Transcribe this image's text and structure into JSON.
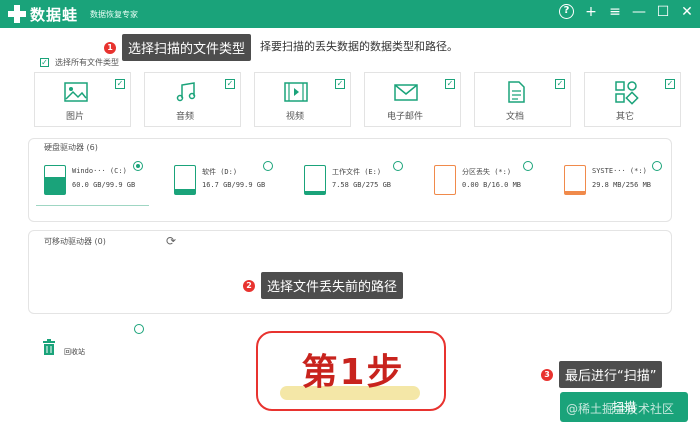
{
  "app": {
    "brand": "数据蛙",
    "subtitle": "数据恢复专家",
    "title_icons": [
      "help-icon",
      "plus-icon",
      "menu-icon",
      "minimize-icon",
      "maximize-icon",
      "close-icon"
    ],
    "accent_color": "#1aa37a"
  },
  "instruction": "择要扫描的丢失数据的数据类型和路径。",
  "callouts": [
    {
      "num": "1",
      "text": "选择扫描的文件类型"
    },
    {
      "num": "2",
      "text": "选择文件丢失前的路径"
    },
    {
      "num": "3",
      "text": "最后进行“扫描”"
    }
  ],
  "select_all": {
    "label": "选择所有文件类型",
    "checked": true
  },
  "file_types": [
    {
      "label": "图片",
      "icon": "image-icon",
      "checked": true
    },
    {
      "label": "音频",
      "icon": "music-icon",
      "checked": true
    },
    {
      "label": "视频",
      "icon": "video-icon",
      "checked": true
    },
    {
      "label": "电子邮件",
      "icon": "email-icon",
      "checked": true
    },
    {
      "label": "文档",
      "icon": "document-icon",
      "checked": true
    },
    {
      "label": "其它",
      "icon": "other-icon",
      "checked": true
    }
  ],
  "hard_drives": {
    "title": "硬盘驱动器 (6)",
    "drives": [
      {
        "name": "Windo··· (C:)",
        "size": "60.0 GB/99.9 GB",
        "fill_fraction": 0.6,
        "color": "green",
        "selected": true
      },
      {
        "name": "软件 (D:)",
        "size": "16.7 GB/99.9 GB",
        "fill_fraction": 0.17,
        "color": "green",
        "selected": false
      },
      {
        "name": "工作文件 (E:)",
        "size": "7.58 GB/275 GB",
        "fill_fraction": 0.03,
        "color": "green",
        "selected": false
      },
      {
        "name": "分区丢失 (*:)",
        "size": "0.00  B/16.0 MB",
        "fill_fraction": 0.0,
        "color": "orange",
        "selected": false
      },
      {
        "name": "SYSTE··· (*:)",
        "size": "29.8 MB/256 MB",
        "fill_fraction": 0.12,
        "color": "orange",
        "selected": false
      }
    ]
  },
  "removable": {
    "title": "可移动驱动器 (0)"
  },
  "recycle_bin": {
    "label": "回收站"
  },
  "step_badge": "第1步",
  "scan_button": "扫描",
  "watermark": "@稀土掘金技术社区"
}
